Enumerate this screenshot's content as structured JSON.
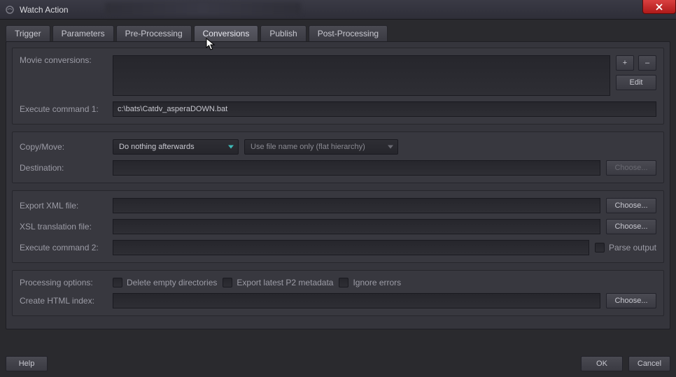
{
  "window": {
    "title": "Watch Action"
  },
  "tabs": [
    "Trigger",
    "Parameters",
    "Pre-Processing",
    "Conversions",
    "Publish",
    "Post-Processing"
  ],
  "activeTab": 3,
  "section1": {
    "movieConversionsLabel": "Movie conversions:",
    "plus": "+",
    "minus": "–",
    "edit": "Edit",
    "execCmd1Label": "Execute command 1:",
    "execCmd1Value": "c:\\bats\\Catdv_asperaDOWN.bat"
  },
  "section2": {
    "copyMoveLabel": "Copy/Move:",
    "copyMoveValue": "Do nothing afterwards",
    "hierarchyValue": "Use file name only (flat hierarchy)",
    "destinationLabel": "Destination:",
    "destinationValue": "",
    "choose": "Choose..."
  },
  "section3": {
    "exportXmlLabel": "Export XML file:",
    "xslLabel": "XSL translation file:",
    "execCmd2Label": "Execute command 2:",
    "parseOutput": "Parse output",
    "choose": "Choose..."
  },
  "section4": {
    "processingLabel": "Processing options:",
    "deleteEmpty": "Delete empty directories",
    "exportP2": "Export latest P2 metadata",
    "ignoreErrors": "Ignore errors",
    "createHtmlLabel": "Create HTML index:",
    "choose": "Choose..."
  },
  "footer": {
    "help": "Help",
    "ok": "OK",
    "cancel": "Cancel"
  }
}
